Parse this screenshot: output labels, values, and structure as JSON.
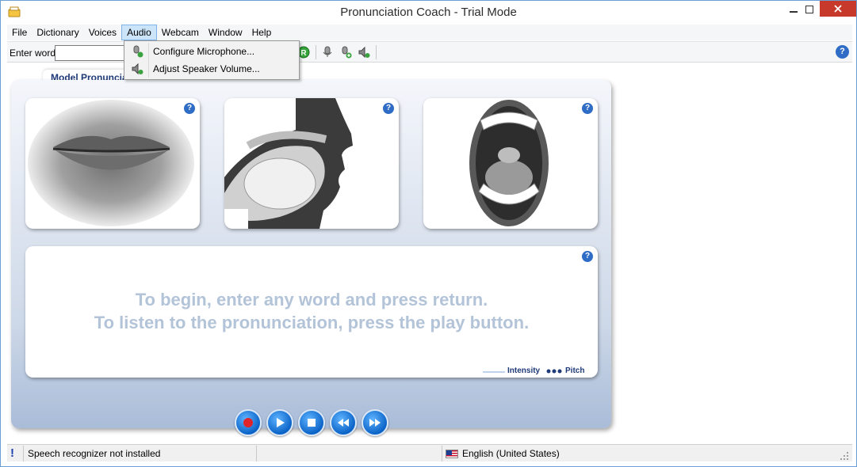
{
  "window": {
    "title": "Pronunciation Coach - Trial Mode"
  },
  "menu": {
    "items": [
      {
        "label": "File"
      },
      {
        "label": "Dictionary"
      },
      {
        "label": "Voices"
      },
      {
        "label": "Audio",
        "active": true
      },
      {
        "label": "Webcam"
      },
      {
        "label": "Window"
      },
      {
        "label": "Help"
      }
    ]
  },
  "toolbar": {
    "enter_word_label": "Enter word:",
    "word_value": ""
  },
  "audio_menu": {
    "items": [
      {
        "label": "Configure Microphone...",
        "icon": "microphone-settings-icon"
      },
      {
        "label": "Adjust Speaker Volume...",
        "icon": "speaker-volume-icon"
      }
    ]
  },
  "panel": {
    "tab_label": "Model Pronuncia",
    "cards": [
      "lips-view",
      "side-profile-view",
      "mouth-interior-view"
    ],
    "instructions": [
      "To begin, enter any word and press return.",
      "To listen to the pronunciation, press the play button."
    ],
    "legend": {
      "intensity": "Intensity",
      "pitch": "Pitch"
    },
    "controls": [
      "record-icon",
      "play-icon",
      "stop-icon",
      "rewind-icon",
      "fast-forward-icon"
    ]
  },
  "status": {
    "speech": "Speech recognizer not installed",
    "language": "English (United States)"
  },
  "colors": {
    "accent": "#1f3a78",
    "control_blue": "#0b63c7",
    "instruction_text": "#b3c4d9"
  }
}
